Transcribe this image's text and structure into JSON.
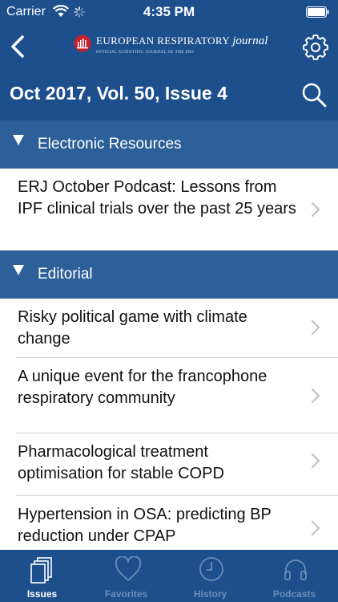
{
  "status_bar": {
    "carrier": "Carrier",
    "time": "4:35 PM"
  },
  "nav": {
    "logo_title": "EUROPEAN RESPIRATORY",
    "logo_title_italic": "journal",
    "logo_subtitle": "OFFICIAL SCIENTIFIC JOURNAL OF THE ERS",
    "issue_title": "Oct 2017, Vol. 50, Issue 4"
  },
  "sections": [
    {
      "title": "Electronic Resources",
      "items": [
        "ERJ October Podcast: Lessons from IPF clinical trials over the past 25 years"
      ]
    },
    {
      "title": "Editorial",
      "items": [
        "Risky political game with climate change",
        "A unique event for the francophone respiratory community",
        "Pharmacological treatment optimisation for stable COPD",
        "Hypertension in OSA: predicting BP reduction under CPAP"
      ]
    }
  ],
  "tabs": [
    {
      "label": "Issues",
      "active": true
    },
    {
      "label": "Favorites",
      "active": false
    },
    {
      "label": "History",
      "active": false
    },
    {
      "label": "Podcasts",
      "active": false
    }
  ],
  "colors": {
    "header": "#1d4f8c",
    "section": "#2d5f99",
    "tab_inactive": "#6c8db7"
  }
}
